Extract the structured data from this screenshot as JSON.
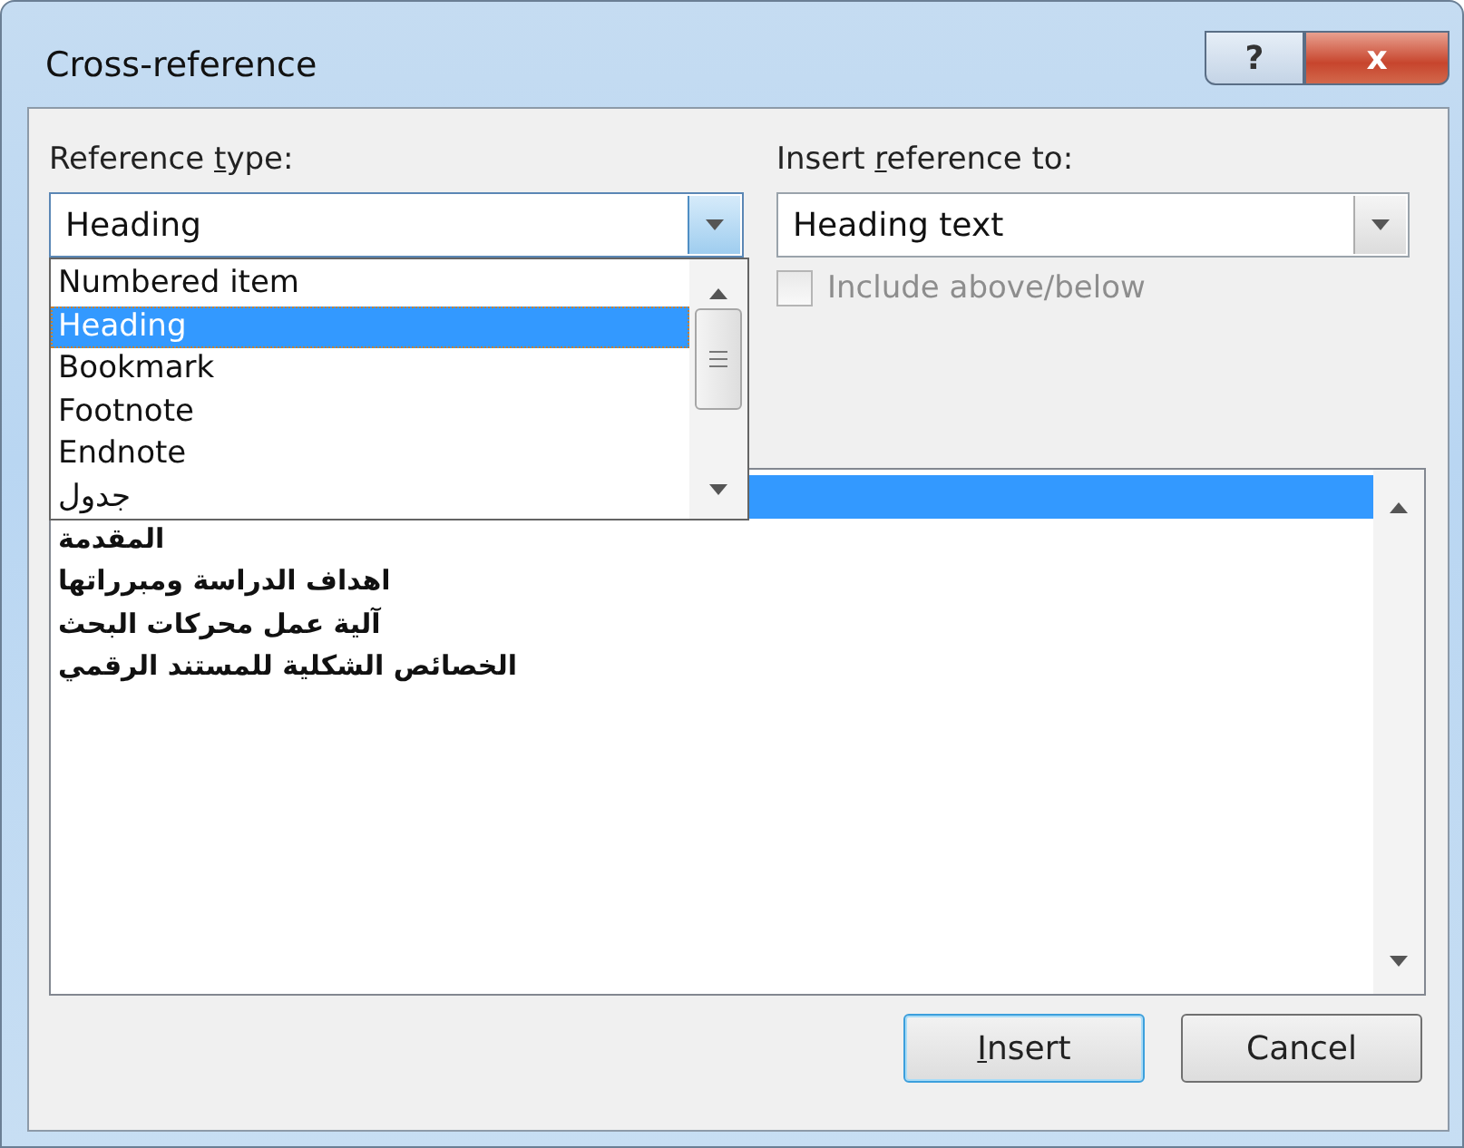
{
  "window": {
    "title": "Cross-reference",
    "help_button": "?",
    "close_button": "x"
  },
  "reference_type": {
    "label": {
      "before": "Reference ",
      "key": "t",
      "after": "ype:"
    },
    "value": "Heading",
    "open": true,
    "options": [
      {
        "text": "Numbered item",
        "selected": false
      },
      {
        "text": "Heading",
        "selected": true
      },
      {
        "text": "Bookmark",
        "selected": false
      },
      {
        "text": "Footnote",
        "selected": false
      },
      {
        "text": "Endnote",
        "selected": false
      },
      {
        "text": "جدول",
        "selected": false
      }
    ]
  },
  "insert_reference_to": {
    "label": {
      "before": "Insert ",
      "key": "r",
      "after": "eference to:"
    },
    "value": "Heading text"
  },
  "include_above_below": {
    "label": "Include above/below",
    "checked": false,
    "disabled": true
  },
  "headings": [
    {
      "selected": true
    },
    {
      "text": "المقدمة",
      "selected": false
    },
    {
      "text": "اهداف الدراسة ومبرراتها",
      "selected": false
    },
    {
      "text": "آلية عمل محركات البحث",
      "selected": false
    },
    {
      "text": "الخصائص الشكلية للمستند الرقمي",
      "selected": false
    }
  ],
  "buttons": [
    {
      "key": "I",
      "after": "nsert",
      "default": true
    },
    {
      "before": "Cancel",
      "default": false
    }
  ]
}
